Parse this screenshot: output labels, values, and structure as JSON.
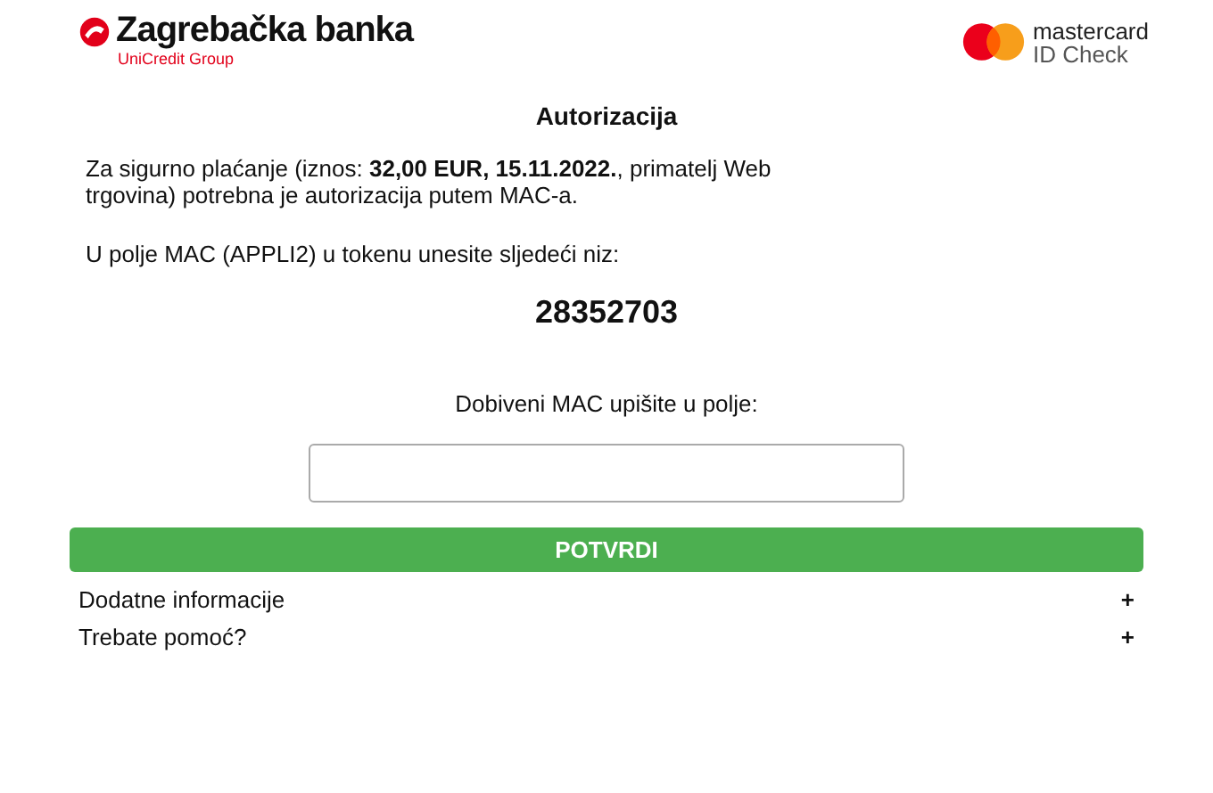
{
  "header": {
    "bank_name": "Zagrebačka banka",
    "bank_group": "UniCredit Group",
    "scheme_name": "mastercard",
    "scheme_product": "ID Check"
  },
  "title": "Autorizacija",
  "intro": "Za sigurno plaćanje (iznos: **32,00 EUR, 15.11.2022.**, primatelj Web trgovina) potrebna je autorizacija putem MAC-a.",
  "instruction": "U polje MAC (APPLI2) u tokenu unesite sljedeći niz:",
  "code": "28352703",
  "field_label": "Dobiveni MAC upišite u polje:",
  "submit_button": "POTVRDI",
  "sections": [
    {
      "label": "Dodatne informacije",
      "icon": "+",
      "expanded": false
    },
    {
      "label": "Trebate pomoć?",
      "icon": "+",
      "expanded": false
    }
  ]
}
